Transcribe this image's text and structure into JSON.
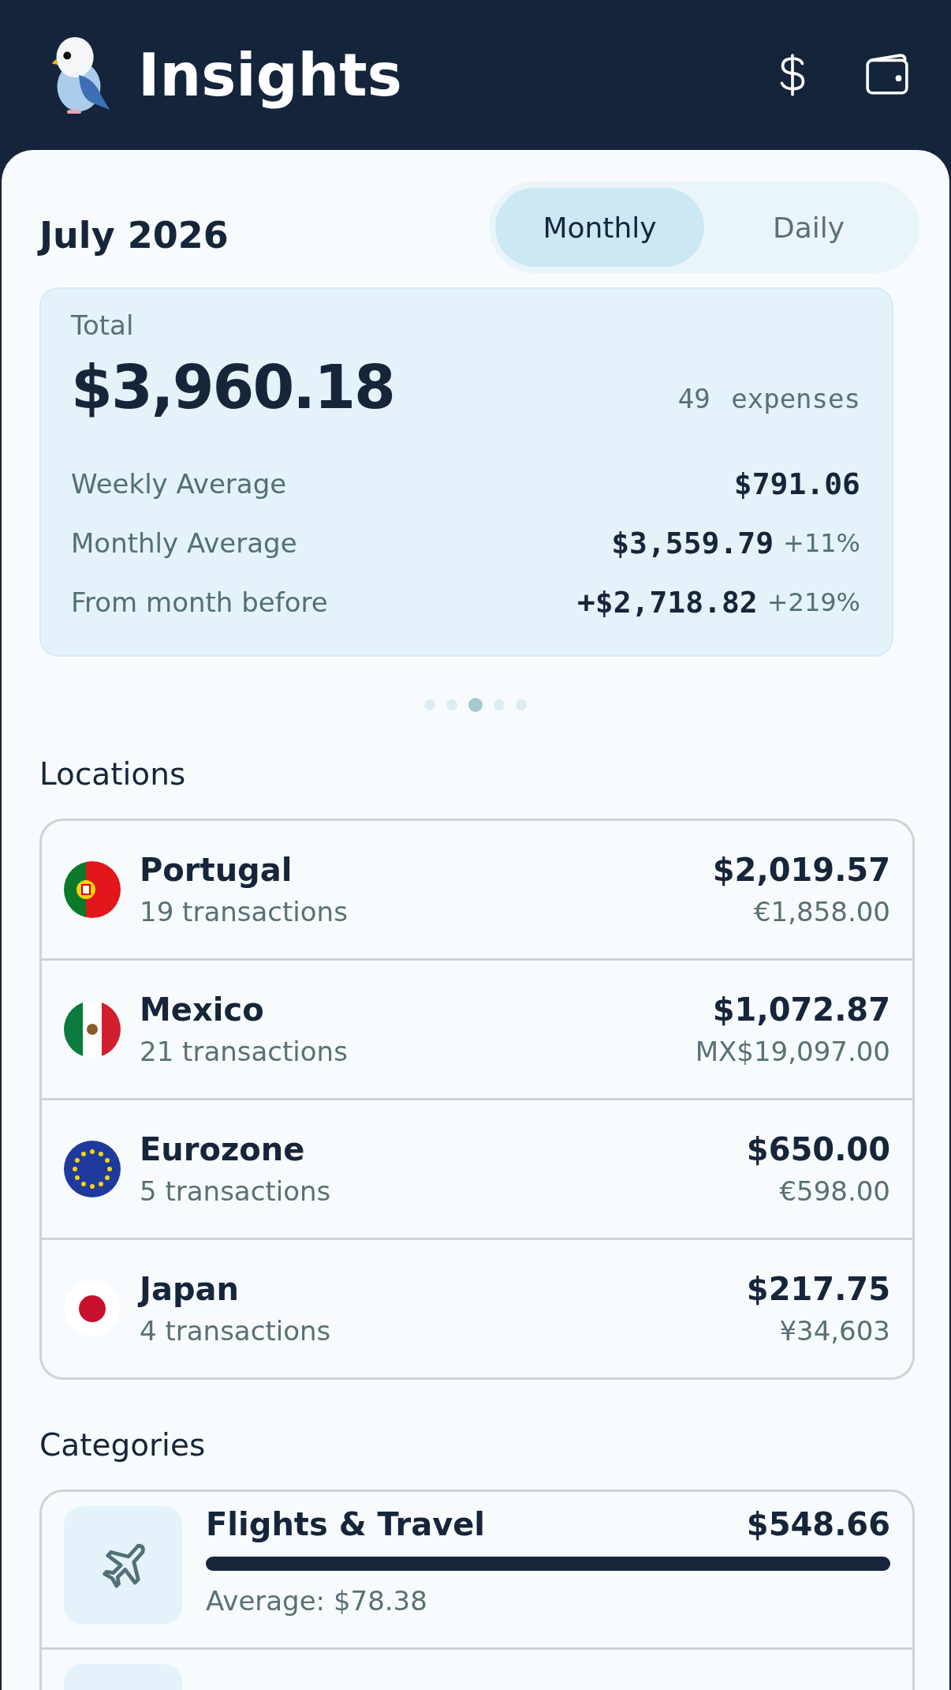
{
  "header": {
    "title": "Insights"
  },
  "period": {
    "title": "July 2026",
    "tabs": [
      {
        "label": "Monthly",
        "selected": true
      },
      {
        "label": "Daily",
        "selected": false
      }
    ]
  },
  "summary": {
    "label": "Total",
    "total": "$3,960.18",
    "count": "49",
    "count_label": "expenses",
    "rows": [
      {
        "label": "Weekly Average",
        "value": "$791.06"
      },
      {
        "label": "Monthly Average",
        "value": "$3,559.79",
        "change": "+11%"
      },
      {
        "label": "From month before",
        "value": "+$2,718.82",
        "change": "+219%"
      }
    ]
  },
  "pager": [
    {
      "selected": false
    },
    {
      "selected": false
    },
    {
      "selected": true
    },
    {
      "selected": false
    },
    {
      "selected": false
    }
  ],
  "locations": {
    "title": "Locations",
    "items": [
      {
        "kind": "portugal",
        "name": "Portugal",
        "transactions": "19 transactions",
        "amount": "$2,019.57",
        "local_amount": "€1,858.00"
      },
      {
        "kind": "mexico",
        "name": "Mexico",
        "transactions": "21 transactions",
        "amount": "$1,072.87",
        "local_amount": "MX$19,097.00"
      },
      {
        "kind": "eu",
        "name": "Eurozone",
        "transactions": "5 transactions",
        "amount": "$650.00",
        "local_amount": "€598.00"
      },
      {
        "kind": "japan",
        "name": "Japan",
        "transactions": "4 transactions",
        "amount": "$217.75",
        "local_amount": "¥34,603"
      }
    ]
  },
  "categories": {
    "title": "Categories",
    "items": [
      {
        "kind": "plane",
        "name": "Flights & Travel",
        "amount": "$548.66",
        "level": 1,
        "average": "Average: $78.38"
      }
    ]
  }
}
